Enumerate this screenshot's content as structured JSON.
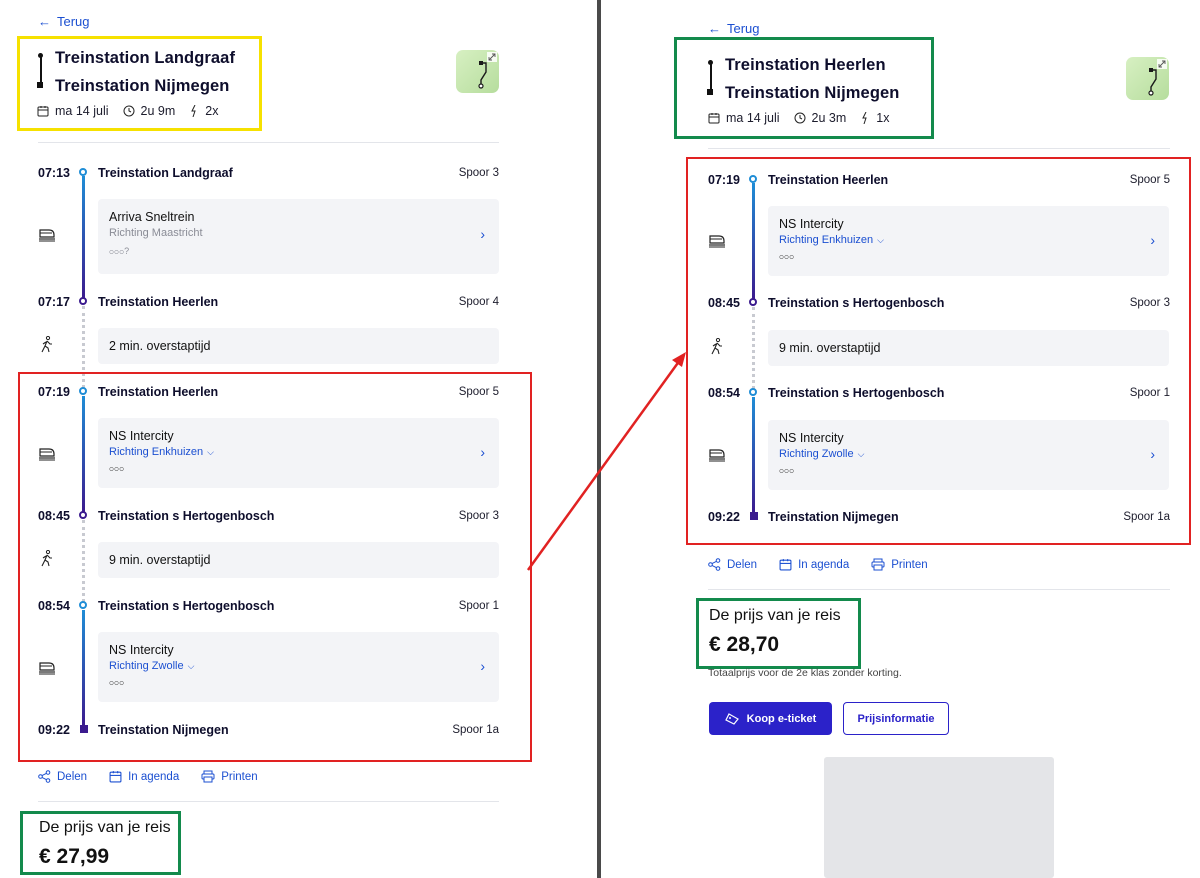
{
  "left": {
    "back_label": "Terug",
    "from": "Treinstation Landgraaf",
    "to": "Treinstation Nijmegen",
    "date": "ma 14 juli",
    "duration": "2u 9m",
    "transfers": "2x",
    "stops": [
      {
        "time": "07:13",
        "station": "Treinstation Landgraaf",
        "platform": "Spoor 3"
      },
      {
        "time": "07:17",
        "station": "Treinstation Heerlen",
        "platform": "Spoor 4"
      },
      {
        "time": "07:19",
        "station": "Treinstation Heerlen",
        "platform": "Spoor 5"
      },
      {
        "time": "08:45",
        "station": "Treinstation s Hertogenbosch",
        "platform": "Spoor 3"
      },
      {
        "time": "08:54",
        "station": "Treinstation s Hertogenbosch",
        "platform": "Spoor 1"
      },
      {
        "time": "09:22",
        "station": "Treinstation Nijmegen",
        "platform": "Spoor 1a"
      }
    ],
    "legs": [
      {
        "train": "Arriva Sneltrein",
        "direction": "Richting Maastricht"
      },
      {
        "train": "NS Intercity",
        "direction": "Richting Enkhuizen"
      },
      {
        "train": "NS Intercity",
        "direction": "Richting Zwolle"
      }
    ],
    "transfers_walk": [
      "2 min. overstaptijd",
      "9 min. overstaptijd"
    ],
    "actions": {
      "share": "Delen",
      "agenda": "In agenda",
      "print": "Printen"
    },
    "price_label": "De prijs van je reis",
    "price_value": "€ 27,99"
  },
  "right": {
    "back_label": "Terug",
    "from": "Treinstation Heerlen",
    "to": "Treinstation Nijmegen",
    "date": "ma 14 juli",
    "duration": "2u 3m",
    "transfers": "1x",
    "stops": [
      {
        "time": "07:19",
        "station": "Treinstation Heerlen",
        "platform": "Spoor 5"
      },
      {
        "time": "08:45",
        "station": "Treinstation s Hertogenbosch",
        "platform": "Spoor 3"
      },
      {
        "time": "08:54",
        "station": "Treinstation s Hertogenbosch",
        "platform": "Spoor 1"
      },
      {
        "time": "09:22",
        "station": "Treinstation Nijmegen",
        "platform": "Spoor 1a"
      }
    ],
    "legs": [
      {
        "train": "NS Intercity",
        "direction": "Richting Enkhuizen"
      },
      {
        "train": "NS Intercity",
        "direction": "Richting Zwolle"
      }
    ],
    "transfers_walk": [
      "9 min. overstaptijd"
    ],
    "actions": {
      "share": "Delen",
      "agenda": "In agenda",
      "print": "Printen"
    },
    "price_label": "De prijs van je reis",
    "price_value": "€ 28,70",
    "price_note": "Totaalprijs voor de 2e klas zonder korting.",
    "buy_button": "Koop e-ticket",
    "info_button": "Prijsinformatie"
  },
  "colors": {
    "link": "#1b4fd1",
    "primary": "#2b22c9",
    "highlight_yellow": "#f6e100",
    "highlight_green": "#138a4c",
    "highlight_red": "#e12222",
    "route_blue": "#1f8dd6",
    "route_purple": "#3b1b8e"
  },
  "icons": [
    "arrow-left-icon",
    "route-icon",
    "calendar-icon",
    "clock-icon",
    "transfer-icon",
    "map-icon",
    "train-icon",
    "walk-icon",
    "crowd-icon",
    "chevron-right-icon",
    "chevron-down-icon",
    "share-icon",
    "print-icon",
    "ticket-icon"
  ]
}
